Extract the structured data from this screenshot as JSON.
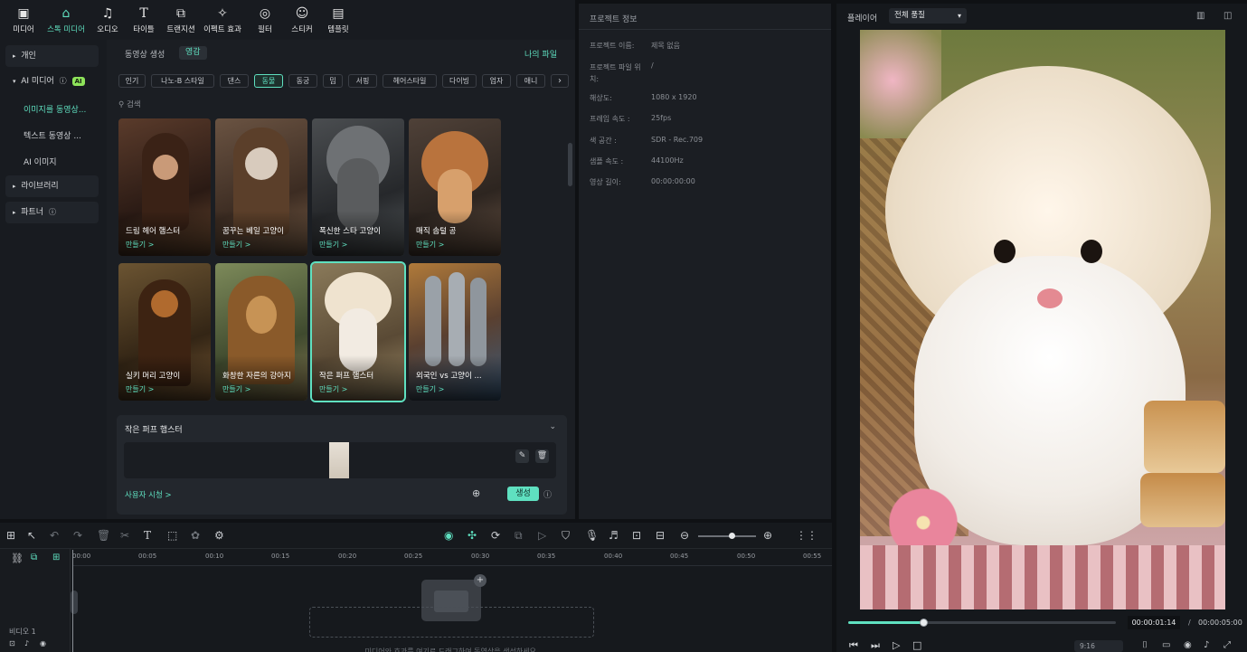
{
  "toolbar": {
    "items": [
      {
        "label": "미디어",
        "icon": "media-icon"
      },
      {
        "label": "스톡 미디어",
        "icon": "stock-media-icon"
      },
      {
        "label": "오디오",
        "icon": "audio-icon"
      },
      {
        "label": "타이틀",
        "icon": "title-icon"
      },
      {
        "label": "트랜지션",
        "icon": "transition-icon"
      },
      {
        "label": "이펙트 효과",
        "icon": "effects-icon"
      },
      {
        "label": "필터",
        "icon": "filter-icon"
      },
      {
        "label": "스티커",
        "icon": "sticker-icon"
      },
      {
        "label": "템플릿",
        "icon": "template-icon"
      }
    ]
  },
  "sidebar": {
    "personal": "개인",
    "ai_media": "AI 미디어",
    "ai_badge": "AI",
    "sub": [
      "이미지를 동영상...",
      "텍스트 동영상 ...",
      "AI 이미지"
    ],
    "library": "라이브러리",
    "partner": "파트너"
  },
  "content": {
    "tabs": [
      "동영상 생성",
      "영감"
    ],
    "my_files": "나의 파일",
    "chips": [
      "인기",
      "나노-B 스타일",
      "댄스",
      "동물",
      "동궁",
      "밈",
      "서핑",
      "헤어스타일",
      "다이빙",
      "업자",
      "애니"
    ],
    "search_placeholder": "검색",
    "cards": [
      {
        "title": "드림 헤어 햄스터",
        "make": "만들기 >"
      },
      {
        "title": "꿈꾸는 베일 고양이",
        "make": "만들기 >"
      },
      {
        "title": "폭신한 스타 고양이",
        "make": "만들기 >"
      },
      {
        "title": "매직 솜털 공",
        "make": "만들기 >"
      },
      {
        "title": "실키 머리 고양이",
        "make": "만들기 >"
      },
      {
        "title": "화창한 자른의 강아지",
        "make": "만들기 >"
      },
      {
        "title": "작은 퍼프 햄스터",
        "make": "만들기 >"
      },
      {
        "title": "외국인 vs 고양이 ...",
        "make": "만들기 >"
      }
    ],
    "selected_title": "작은 퍼프 햄스터",
    "usage_link": "사용자 시청 >",
    "generate": "생성"
  },
  "project": {
    "header": "프로젝트 정보",
    "rows": [
      {
        "key": "프로젝트 이름:",
        "value": "제목 없음"
      },
      {
        "key": "프로젝트 파일 위치:",
        "value": "/"
      },
      {
        "key": "해상도:",
        "value": "1080 x 1920"
      },
      {
        "key": "프레임 속도 :",
        "value": "25fps"
      },
      {
        "key": "색 공간 :",
        "value": "SDR - Rec.709"
      },
      {
        "key": "샘플 속도 :",
        "value": "44100Hz"
      },
      {
        "key": "영상 길이:",
        "value": "00:00:00:00"
      }
    ]
  },
  "player": {
    "label": "플레이어",
    "quality": "전체 품질",
    "current_time": "00:00:01:14",
    "separator": "/",
    "total_time": "00:00:05:00",
    "progress": 0.28,
    "ratio": "9:16"
  },
  "timeline": {
    "ticks": [
      "00:00",
      "00:05",
      "00:10",
      "00:15",
      "00:20",
      "00:25",
      "00:30",
      "00:35",
      "00:40",
      "00:45",
      "00:50",
      "00:55"
    ],
    "track_label": "비디오 1",
    "drop_hint": "미디어와 효과를 여기로 드래그하여 동영상을 생성하세요."
  },
  "colors": {
    "accent": "#5fe0c0",
    "bg": "#0f1114",
    "panel": "#1b1e23"
  }
}
